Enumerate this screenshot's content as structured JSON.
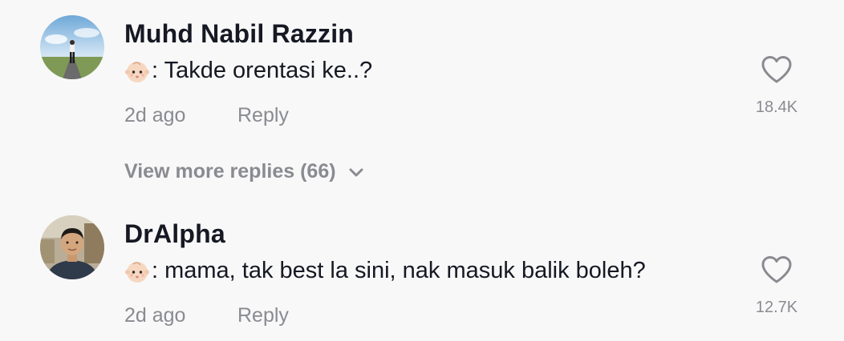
{
  "comments": [
    {
      "username": "Muhd Nabil Razzin",
      "emoji": "baby-face-emoji",
      "text": ": Takde orentasi ke..?",
      "time": "2d ago",
      "reply_label": "Reply",
      "likes": "18.4K",
      "avatar": "person-in-field-avatar"
    },
    {
      "username": "DrAlpha",
      "emoji": "baby-face-emoji",
      "text": ": mama, tak best la sini, nak masuk balik boleh?",
      "time": "2d ago",
      "reply_label": "Reply",
      "likes": "12.7K",
      "avatar": "man-portrait-avatar"
    }
  ],
  "view_more_label": "View more replies (66)",
  "colors": {
    "background": "#f8f8f8",
    "username": "#161823",
    "secondary": "#8a8b91"
  }
}
